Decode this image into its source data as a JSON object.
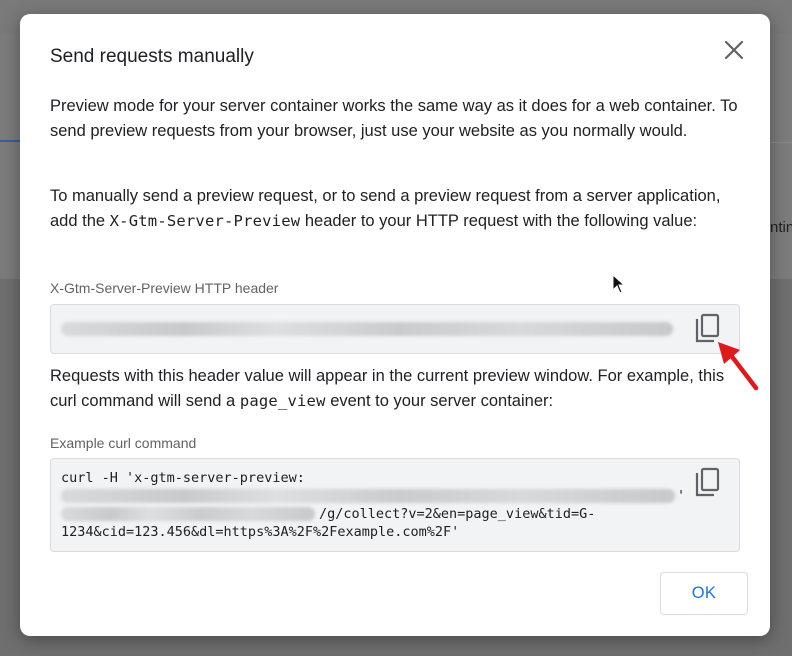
{
  "background": {
    "partial_text": "ntin"
  },
  "dialog": {
    "title": "Send requests manually",
    "paragraph1": "Preview mode for your server container works the same way as it does for a web container. To send preview requests from your browser, just use your website as you normally would.",
    "paragraph2_before": "To manually send a preview request, or to send a preview request from a server application, add the ",
    "paragraph2_code": "X-Gtm-Server-Preview",
    "paragraph2_after": " header to your HTTP request with the following value:",
    "header_field_label": "X-Gtm-Server-Preview HTTP header",
    "paragraph3_before": "Requests with this header value will appear in the current preview window. For example, this curl command will send a ",
    "paragraph3_code": "page_view",
    "paragraph3_after": " event to your server container:",
    "curl_field_label": "Example curl command",
    "curl_line1": "curl -H 'x-gtm-server-preview:",
    "curl_line2_end": "'",
    "curl_line3_tail": "/g/collect?v=2&en=page_view&tid=G-",
    "curl_line4": "1234&cid=123.456&dl=https%3A%2F%2Fexample.com%2F'",
    "ok_label": "OK"
  },
  "icons": {
    "close": "close-icon",
    "copy": "copy-icon",
    "annotation_arrow": "red-arrow-icon",
    "cursor": "mouse-pointer-icon"
  },
  "colors": {
    "accent": "#1a73e8",
    "arrow": "#e0191b",
    "text": "#202124",
    "label": "#5f6368"
  }
}
